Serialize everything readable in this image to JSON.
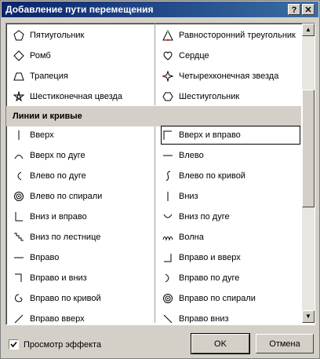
{
  "window": {
    "title": "Добавление пути перемещения",
    "help_label": "?",
    "close_label": "✕"
  },
  "list": {
    "top_items": [
      {
        "left": "Пятиугольник",
        "left_icon": "pentagon-icon",
        "right": "Равносторонний треугольник",
        "right_icon": "triangle-icon"
      },
      {
        "left": "Ромб",
        "left_icon": "rhombus-icon",
        "right": "Сердце",
        "right_icon": "heart-icon"
      },
      {
        "left": "Трапеция",
        "left_icon": "trapezoid-icon",
        "right": "Четырехконечная звезда",
        "right_icon": "four-point-star-icon"
      },
      {
        "left": "Шестиконечная цвезда",
        "left_icon": "six-point-star-icon",
        "right": "Шестиугольник",
        "right_icon": "hexagon-icon"
      }
    ],
    "section_label": "Линии и кривые",
    "line_items": [
      {
        "left": "Вверх",
        "right": "Вверх и вправо"
      },
      {
        "left": "Вверх по дуге",
        "right": "Влево"
      },
      {
        "left": "Влево по дуге",
        "right": "Влево по кривой"
      },
      {
        "left": "Влево по спирали",
        "right": "Вниз"
      },
      {
        "left": "Вниз и вправо",
        "right": "Вниз по дуге"
      },
      {
        "left": "Вниз по лестнице",
        "right": "Волна"
      },
      {
        "left": "Вправо",
        "right": "Вправо и вверх"
      },
      {
        "left": "Вправо и вниз",
        "right": "Вправо по дуге"
      },
      {
        "left": "Вправо по кривой",
        "right": "Вправо по спирали"
      },
      {
        "left": "Вправо вверх",
        "right": "Вправо вниз"
      }
    ],
    "selected_item": "Вверх и вправо"
  },
  "footer": {
    "preview_label": "Просмотр эффекта",
    "preview_checked": true,
    "ok_label": "OK",
    "cancel_label": "Отмена"
  }
}
